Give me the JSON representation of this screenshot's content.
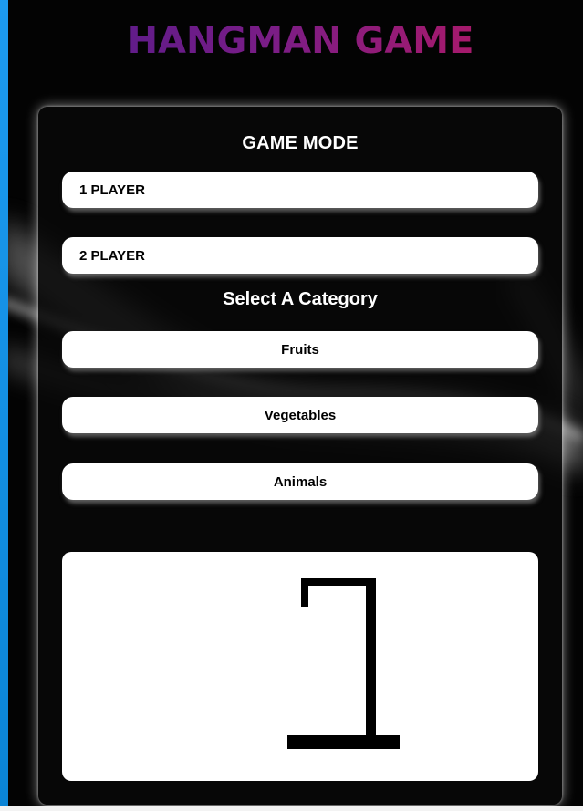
{
  "app": {
    "title": "HANGMAN GAME"
  },
  "game_mode": {
    "heading": "GAME MODE",
    "options": [
      {
        "label": "1 PLAYER"
      },
      {
        "label": "2 PLAYER"
      }
    ]
  },
  "category": {
    "heading": "Select A Category",
    "options": [
      {
        "label": "Fruits"
      },
      {
        "label": "Vegetables"
      },
      {
        "label": "Animals"
      }
    ]
  },
  "gallows": {
    "icon": "gallows-icon",
    "stroke_color": "#000000"
  },
  "colors": {
    "title_gradient_start": "#4a1a8c",
    "title_gradient_end": "#c2185b",
    "accent_bar": "#1d9bf0",
    "panel_background": "#080808",
    "button_background": "#ffffff"
  }
}
